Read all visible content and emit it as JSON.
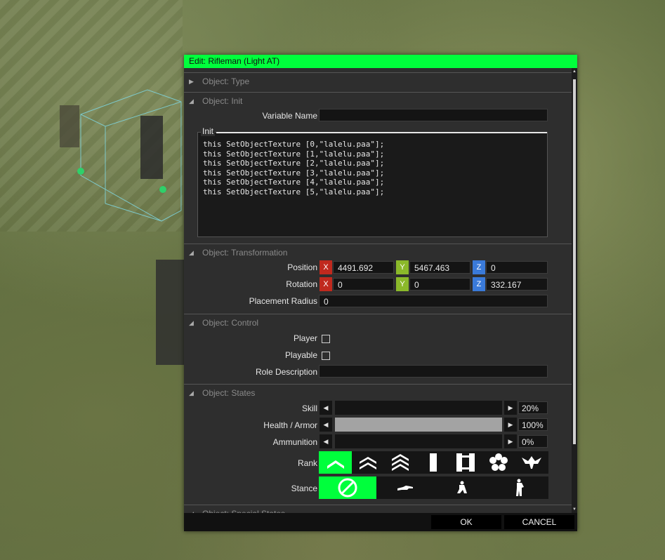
{
  "dialog": {
    "title": "Edit: Rifleman (Light AT)"
  },
  "sections": {
    "type": "Object: Type",
    "init": "Object: Init",
    "transformation": "Object: Transformation",
    "control": "Object: Control",
    "states": "Object: States",
    "special_states": "Object: Special States"
  },
  "init": {
    "variable_name_label": "Variable Name",
    "variable_name_value": "",
    "init_label": "Init",
    "init_code": "this SetObjectTexture [0,\"lalelu.paa\"];\nthis SetObjectTexture [1,\"lalelu.paa\"];\nthis SetObjectTexture [2,\"lalelu.paa\"];\nthis SetObjectTexture [3,\"lalelu.paa\"];\nthis SetObjectTexture [4,\"lalelu.paa\"];\nthis SetObjectTexture [5,\"lalelu.paa\"];"
  },
  "transformation": {
    "position_label": "Position",
    "position": {
      "x": "4491.692",
      "y": "5467.463",
      "z": "0"
    },
    "rotation_label": "Rotation",
    "rotation": {
      "x": "0",
      "y": "0",
      "z": "332.167"
    },
    "placement_radius_label": "Placement Radius",
    "placement_radius": "0",
    "axis_labels": {
      "x": "X",
      "y": "Y",
      "z": "Z"
    }
  },
  "control": {
    "player_label": "Player",
    "playable_label": "Playable",
    "role_description_label": "Role Description",
    "role_description": ""
  },
  "states": {
    "skill_label": "Skill",
    "skill_value": "20%",
    "skill_fraction": 0.0,
    "health_label": "Health / Armor",
    "health_value": "100%",
    "health_fraction": 1.0,
    "ammo_label": "Ammunition",
    "ammo_value": "0%",
    "ammo_fraction": 0.0,
    "rank_label": "Rank",
    "ranks": [
      "private-icon",
      "corporal-icon",
      "sergeant-icon",
      "lieutenant-icon",
      "captain-icon",
      "major-icon",
      "colonel-icon"
    ],
    "selected_rank": 0,
    "stance_label": "Stance",
    "stances": [
      "auto-stance-icon",
      "prone-icon",
      "crouch-icon",
      "stand-icon"
    ],
    "selected_stance": 0
  },
  "footer": {
    "ok_label": "OK",
    "cancel_label": "CANCEL"
  },
  "colors": {
    "accent": "#00ff3c",
    "axis_x": "#c0291e",
    "axis_y": "#8bb92a",
    "axis_z": "#3a7ad9"
  }
}
